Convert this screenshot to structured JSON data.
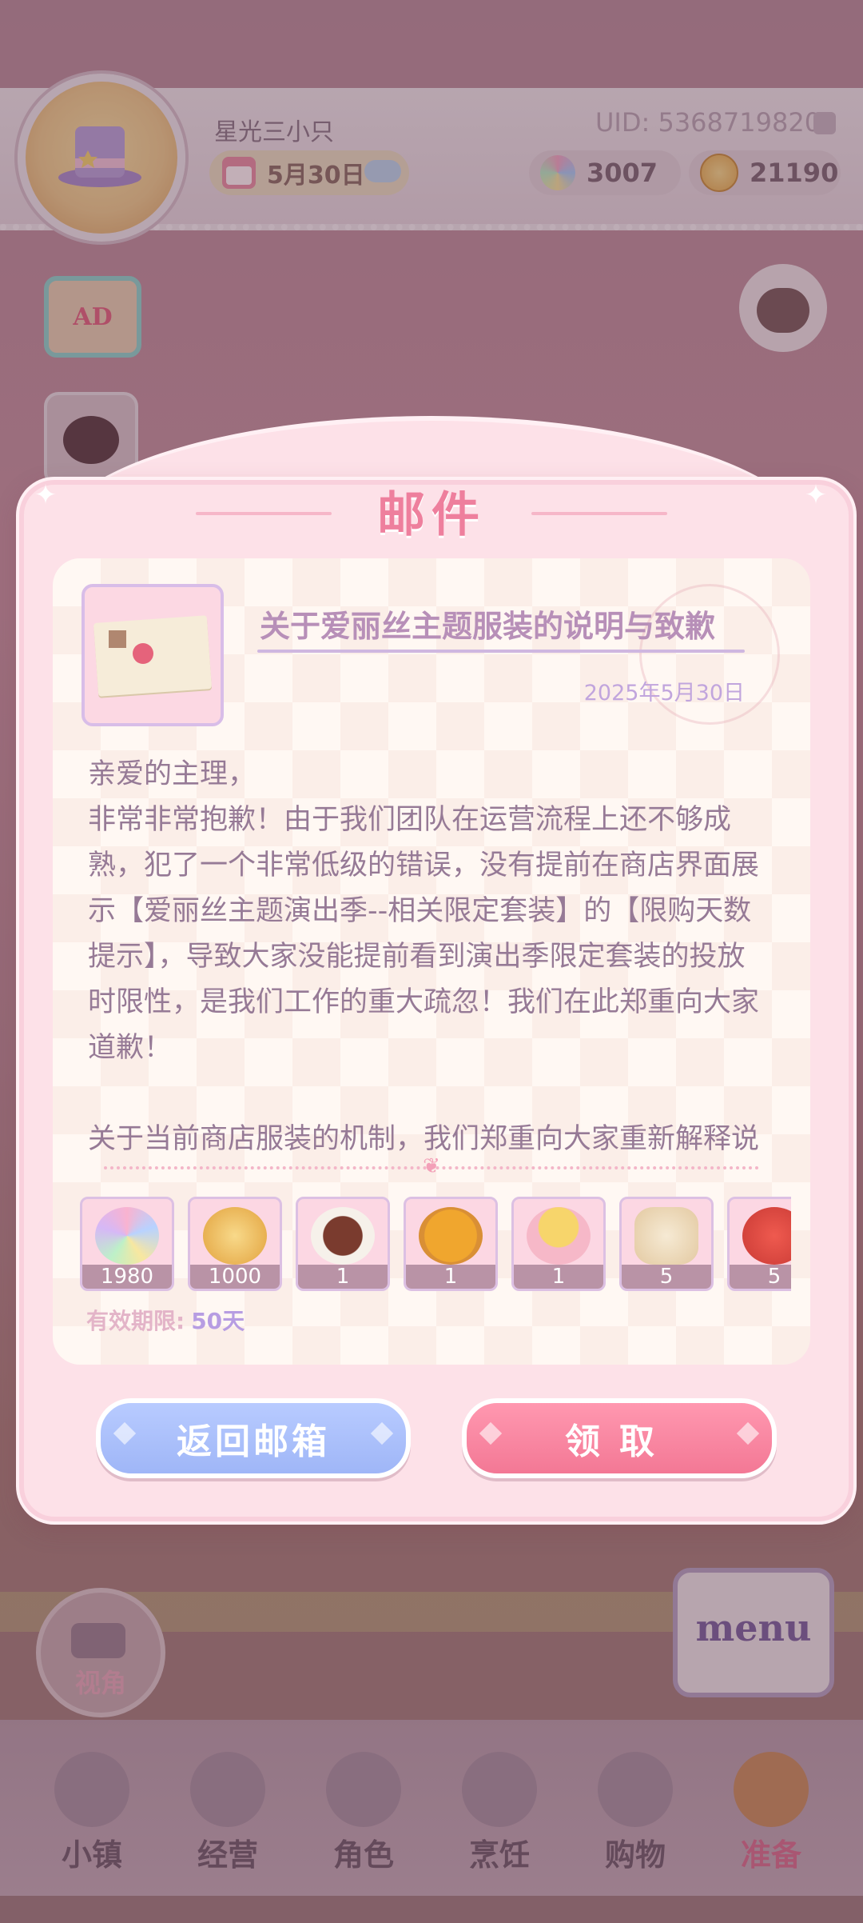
{
  "header": {
    "nickname": "星光三小只",
    "date": "5月30日",
    "uid": "UID: 5368719820",
    "gems": "3007",
    "coins": "21190"
  },
  "side_buttons": {
    "ad_label": "AD"
  },
  "mail": {
    "dialog_title": "邮件",
    "subject": "关于爱丽丝主题服装的说明与致歉",
    "date": "2025年5月30日",
    "body_lines": [
      "亲爱的主理，",
      "非常非常抱歉！由于我们团队在运营流程上还不够成",
      "熟，犯了一个非常低级的错误，没有提前在商店界面展",
      "示【爱丽丝主题演出季--相关限定套装】的【限购天数",
      "提示】，导致大家没能提前看到演出季限定套装的投放",
      "时限性，是我们工作的重大疏忽！我们在此郑重向大家",
      "道歉！",
      "",
      "关于当前商店服装的机制，我们郑重向大家重新解释说"
    ],
    "attachments": [
      {
        "name": "rainbow-crystal",
        "qty": "1980",
        "color": "#c9d6ff"
      },
      {
        "name": "gold-coins",
        "qty": "1000",
        "color": "#f1c15d"
      },
      {
        "name": "steak-dish",
        "qty": "1",
        "color": "#8a4a3a"
      },
      {
        "name": "orange-tart",
        "qty": "1",
        "color": "#f2a93c"
      },
      {
        "name": "fruit-sundae",
        "qty": "1",
        "color": "#f7d36b"
      },
      {
        "name": "flour-sack",
        "qty": "5",
        "color": "#efdcc0"
      },
      {
        "name": "strawberry",
        "qty": "5",
        "color": "#e2453f"
      }
    ],
    "validity_label": "有效期限:",
    "validity_value": "50天",
    "back_button": "返回邮箱",
    "claim_button": "领取"
  },
  "bottom": {
    "view_label": "视角",
    "menu_label": "menu",
    "nav": [
      {
        "label": "小镇",
        "active": false
      },
      {
        "label": "经营",
        "active": false
      },
      {
        "label": "角色",
        "active": false
      },
      {
        "label": "烹饪",
        "active": false
      },
      {
        "label": "购物",
        "active": false
      },
      {
        "label": "准备",
        "active": true
      }
    ]
  }
}
